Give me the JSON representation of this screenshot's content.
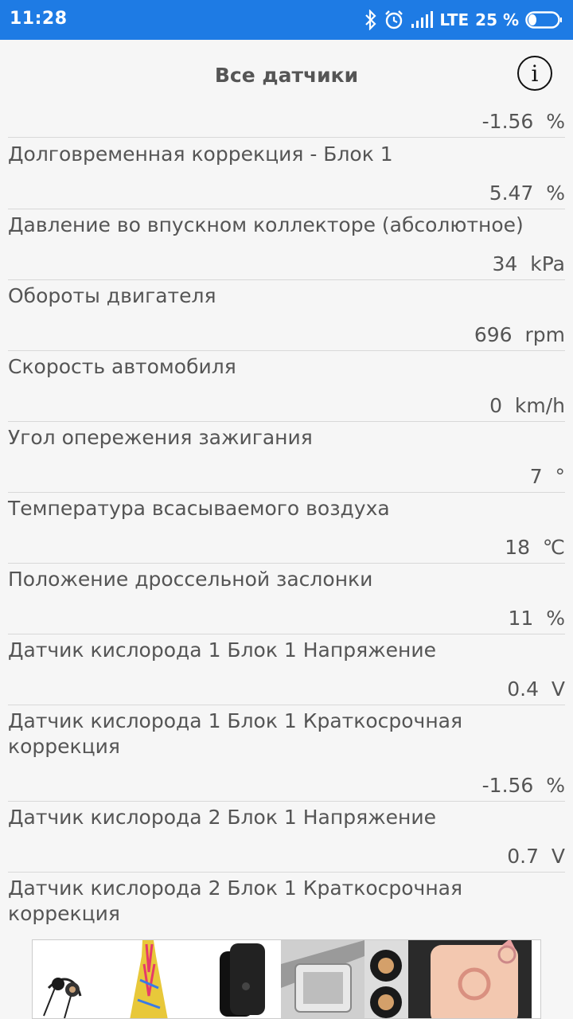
{
  "status_bar": {
    "time": "11:28",
    "network": "LTE",
    "battery": "25 %",
    "icons": [
      "bluetooth-icon",
      "alarm-icon",
      "signal-icon",
      "battery-icon"
    ]
  },
  "header": {
    "title": "Все датчики",
    "info_icon": "i"
  },
  "sensors": {
    "partial_value": "-1.56  %",
    "items": [
      {
        "label": "Долговременная коррекция - Блок 1",
        "value": "5.47  %"
      },
      {
        "label": "Давление во впускном коллекторе (абсолютное)",
        "value": "34  kPa"
      },
      {
        "label": "Обороты двигателя",
        "value": "696  rpm"
      },
      {
        "label": "Скорость автомобиля",
        "value": "0  km/h"
      },
      {
        "label": "Угол опережения зажигания",
        "value": "7  °"
      },
      {
        "label": "Температура всасываемого воздуха",
        "value": "18  ℃"
      },
      {
        "label": "Положение дроссельной заслонки",
        "value": "11  %"
      },
      {
        "label": "Датчик кислорода 1 Блок 1 Напряжение",
        "value": "0.4  V"
      },
      {
        "label": "Датчик кислорода 1 Блок 1 Краткосрочная коррекция",
        "value": "-1.56  %"
      },
      {
        "label": "Датчик кислорода 2 Блок 1 Напряжение",
        "value": "0.7  V"
      },
      {
        "label": "Датчик кислорода 2 Блок 1 Краткосрочная коррекция",
        "value": ""
      }
    ]
  },
  "ad": {
    "items": [
      "earphones",
      "dress",
      "phone-case",
      "car-holder",
      "phone-ring"
    ]
  }
}
